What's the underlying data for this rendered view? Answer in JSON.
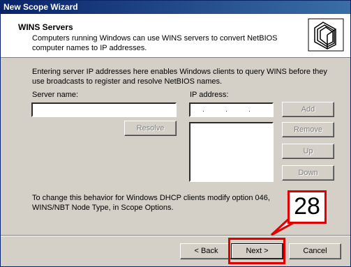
{
  "window": {
    "title": "New Scope Wizard"
  },
  "header": {
    "title": "WINS Servers",
    "subtitle": "Computers running Windows can use WINS servers to convert NetBIOS computer names to IP addresses."
  },
  "body": {
    "intro": "Entering server IP addresses here enables Windows clients to query WINS before they use broadcasts to register and resolve NetBIOS names.",
    "server_name_label": "Server name:",
    "server_name_value": "",
    "ip_label": "IP address:",
    "ip_value": ". . .",
    "resolve_label": "Resolve",
    "add_label": "Add",
    "remove_label": "Remove",
    "up_label": "Up",
    "down_label": "Down",
    "footer_text": "To change this behavior for Windows DHCP clients modify option 046, WINS/NBT Node Type, in Scope Options."
  },
  "buttons": {
    "back": "< Back",
    "next": "Next >",
    "cancel": "Cancel"
  },
  "annotation": {
    "step_number": "28",
    "color": "#e00000"
  }
}
